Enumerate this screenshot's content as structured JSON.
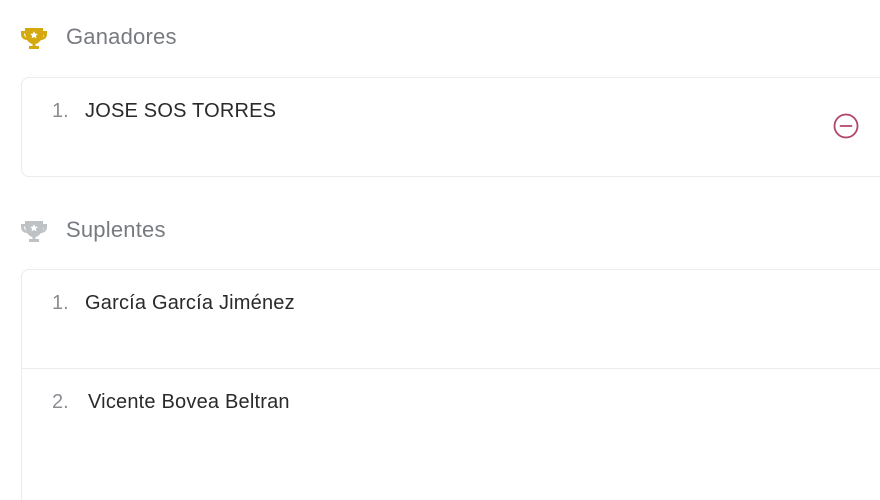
{
  "ganadores": {
    "title": "Ganadores",
    "icon": "trophy-gold-icon",
    "icon_color": "#d4a80f",
    "items": [
      {
        "number": "1.",
        "name": "JOSE SOS TORRES"
      }
    ],
    "remove_icon": "minus-circle-icon",
    "remove_color": "#b1446a"
  },
  "suplentes": {
    "title": "Suplentes",
    "icon": "trophy-silver-icon",
    "icon_color": "#bfc2c5",
    "items": [
      {
        "number": "1.",
        "name": "García García Jiménez"
      },
      {
        "number": "2.",
        "name": "Vicente Bovea Beltran"
      }
    ]
  }
}
